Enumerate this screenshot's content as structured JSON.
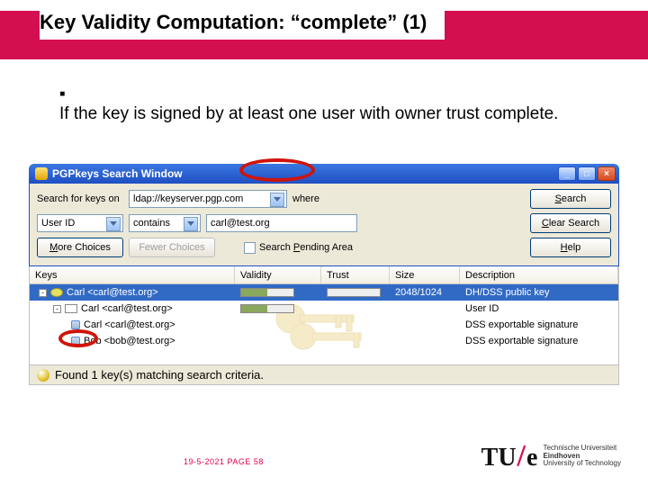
{
  "slide": {
    "title": "Key Validity Computation: “complete” (1)",
    "bullet": "If the key is signed by at least one user with owner trust complete.",
    "footer": "19-5-2021   PAGE 58"
  },
  "window": {
    "title": "PGPkeys Search Window",
    "win_min": "_",
    "win_max": "□",
    "win_close": "×",
    "search_on_label": "Search for keys on",
    "server_value": "ldap://keyserver.pgp.com",
    "where_label": "where",
    "search_btn": "Search",
    "userid_label": "User ID",
    "contains_value": "contains",
    "query_value": "carl@test.org",
    "clear_btn": "Clear Search",
    "more_btn": "More Choices",
    "fewer_btn": "Fewer Choices",
    "pending_label": "Search Pending Area",
    "help_btn": "Help",
    "columns": {
      "keys": "Keys",
      "validity": "Validity",
      "trust": "Trust",
      "size": "Size",
      "description": "Description"
    },
    "rows": [
      {
        "indent": 0,
        "exp": "-",
        "icon": "key",
        "label": "Carl <carl@test.org>",
        "validity_half": true,
        "size": "2048/1024",
        "desc": "DH/DSS public key",
        "selected": true
      },
      {
        "indent": 1,
        "exp": "-",
        "icon": "env",
        "label": "Carl <carl@test.org>",
        "desc": "User ID"
      },
      {
        "indent": 2,
        "exp": "",
        "icon": "sig",
        "label": "Carl <carl@test.org>",
        "desc": "DSS exportable signature"
      },
      {
        "indent": 2,
        "exp": "",
        "icon": "sig",
        "label": "Bob <bob@test.org>",
        "desc": "DSS exportable signature"
      }
    ],
    "status": "Found 1 key(s) matching search criteria."
  },
  "branding": {
    "logo_text_left": "TU",
    "logo_text_right": "e",
    "line1": "Technische Universiteit",
    "line2": "Eindhoven",
    "line3": "University of Technology"
  }
}
